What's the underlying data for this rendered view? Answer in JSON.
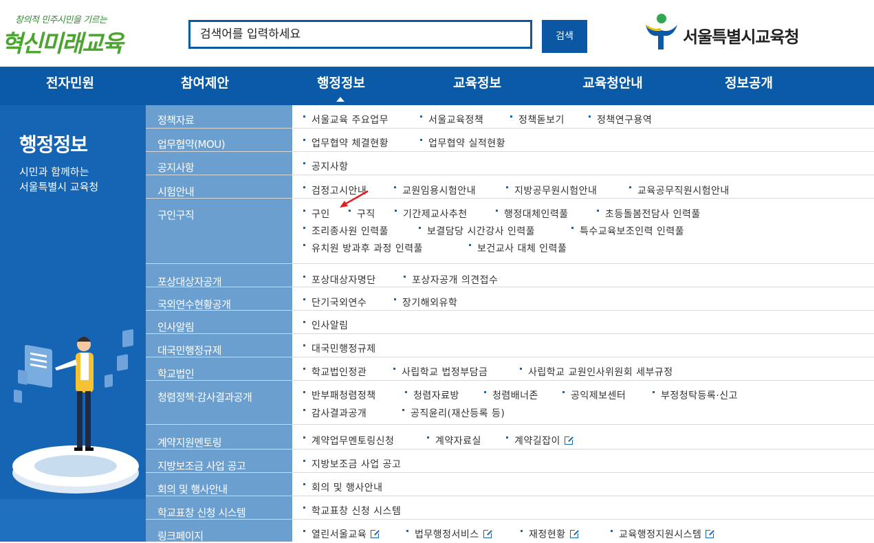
{
  "header": {
    "slogan_small": "창의적 민주시민을 기르는",
    "slogan_main": "혁신미래교육",
    "search_placeholder": "검색어를 입력하세요",
    "search_button": "검색",
    "brand_name": "서울특별시교육청"
  },
  "nav": {
    "items": [
      "전자민원",
      "참여제안",
      "행정정보",
      "교육정보",
      "교육청안내",
      "정보공개"
    ],
    "active": "행정정보"
  },
  "left_panel": {
    "title": "행정정보",
    "desc_line1": "시민과 함께하는",
    "desc_line2": "서울특별시 교육청"
  },
  "menu": [
    {
      "category": "정책자료",
      "links": [
        "서울교육 주요업무",
        "서울교육정책",
        "정책돋보기",
        "정책연구용역"
      ]
    },
    {
      "category": "업무협약(MOU)",
      "links": [
        "업무협약 체결현황",
        "업무협약 실적현황"
      ]
    },
    {
      "category": "공지사항",
      "links": [
        "공지사항"
      ]
    },
    {
      "category": "시험안내",
      "links": [
        "검정고시안내",
        "교원임용시험안내",
        "지방공무원시험안내",
        "교육공무직원시험안내"
      ]
    },
    {
      "category": "구인구직",
      "links": [
        "구인",
        "구직",
        "기간제교사추천",
        "행정대체인력풀",
        "초등돌봄전담사 인력풀",
        "조리종사원 인력풀",
        "보결담당 시간강사 인력풀",
        "특수교육보조인력 인력풀",
        "유치원 방과후 과정 인력풀",
        "보건교사 대체 인력풀"
      ]
    },
    {
      "category": "포상대상자공개",
      "links": [
        "포상대상자명단",
        "포상자공개 의견접수"
      ]
    },
    {
      "category": "국외연수현황공개",
      "links": [
        "단기국외연수",
        "장기해외유학"
      ]
    },
    {
      "category": "인사알림",
      "links": [
        "인사알림"
      ]
    },
    {
      "category": "대국민행정규제",
      "links": [
        "대국민행정규제"
      ]
    },
    {
      "category": "학교법인",
      "links": [
        "학교법인정관",
        "사립학교 법정부담금",
        "사립학교 교원인사위원회 세부규정"
      ]
    },
    {
      "category": "청렴정책·감사결과공개",
      "links": [
        "반부패청렴정책",
        "청렴자료방",
        "청렴배너존",
        "공익제보센터",
        "부정청탁등록·신고",
        "감사결과공개",
        "공직윤리(재산등록 등)"
      ]
    },
    {
      "category": "계약지원멘토링",
      "links": [
        "계약업무멘토링신청",
        "계약자료실",
        "계약길잡이"
      ]
    },
    {
      "category": "지방보조금 사업 공고",
      "links": [
        "지방보조금 사업 공고"
      ]
    },
    {
      "category": "회의 및 행사안내",
      "links": [
        "회의 및 행사안내"
      ]
    },
    {
      "category": "학교표창 신청 시스템",
      "links": [
        "학교표창 신청 시스템"
      ]
    },
    {
      "category": "링크페이지",
      "links": [
        "열린서울교육",
        "법무행정서비스",
        "재정현황",
        "교육행정지원시스템"
      ]
    }
  ],
  "colors": {
    "nav_bg": "#0b5aa7",
    "left_panel_bg": "#1565b4",
    "category_bg": "#6a9fd0",
    "annotation_arrow": "#e02020"
  }
}
